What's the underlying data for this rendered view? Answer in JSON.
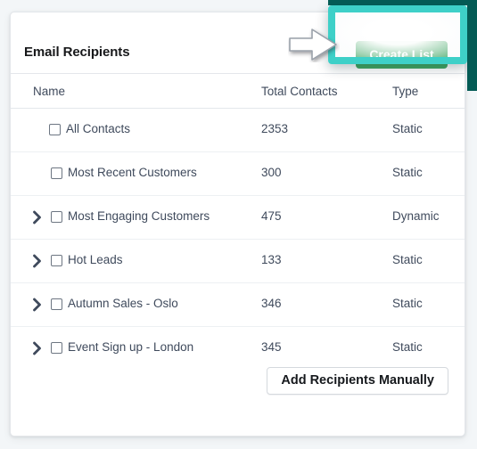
{
  "card": {
    "title": "Email Recipients",
    "create_list_label": "Create List",
    "add_recipients_label": "Add Recipients Manually"
  },
  "table": {
    "columns": [
      "Name",
      "Total Contacts",
      "Type"
    ],
    "rows": [
      {
        "name": "All Contacts",
        "contacts": "2353",
        "type": "Static",
        "expandable": false,
        "indent": 0,
        "checked": false
      },
      {
        "name": "Most Recent Customers",
        "contacts": "300",
        "type": "Static",
        "expandable": false,
        "indent": 1,
        "checked": false
      },
      {
        "name": "Most Engaging Customers",
        "contacts": "475",
        "type": "Dynamic",
        "expandable": true,
        "indent": 1,
        "checked": false
      },
      {
        "name": "Hot Leads",
        "contacts": "133",
        "type": "Static",
        "expandable": true,
        "indent": 1,
        "checked": false
      },
      {
        "name": "Autumn Sales - Oslo",
        "contacts": "346",
        "type": "Static",
        "expandable": true,
        "indent": 1,
        "checked": false
      },
      {
        "name": "Event Sign up - London",
        "contacts": "345",
        "type": "Static",
        "expandable": true,
        "indent": 1,
        "checked": false
      }
    ]
  },
  "annotation": {
    "highlight_target": "create-list-button",
    "arrow_direction": "right",
    "highlight_color": "#3ed0c8",
    "edge_strip_color": "#045b55"
  },
  "colors": {
    "page_background": "#f3f6f8",
    "card_background": "#ffffff",
    "primary_button": "#42a864",
    "text": "#3f4a5c",
    "title_text": "#17181a",
    "border": "#e4e7eb"
  },
  "icons": {
    "chevron": "chevron-right-icon",
    "checkbox": "checkbox-unchecked-icon",
    "arrow": "arrow-right-annotation-icon"
  }
}
